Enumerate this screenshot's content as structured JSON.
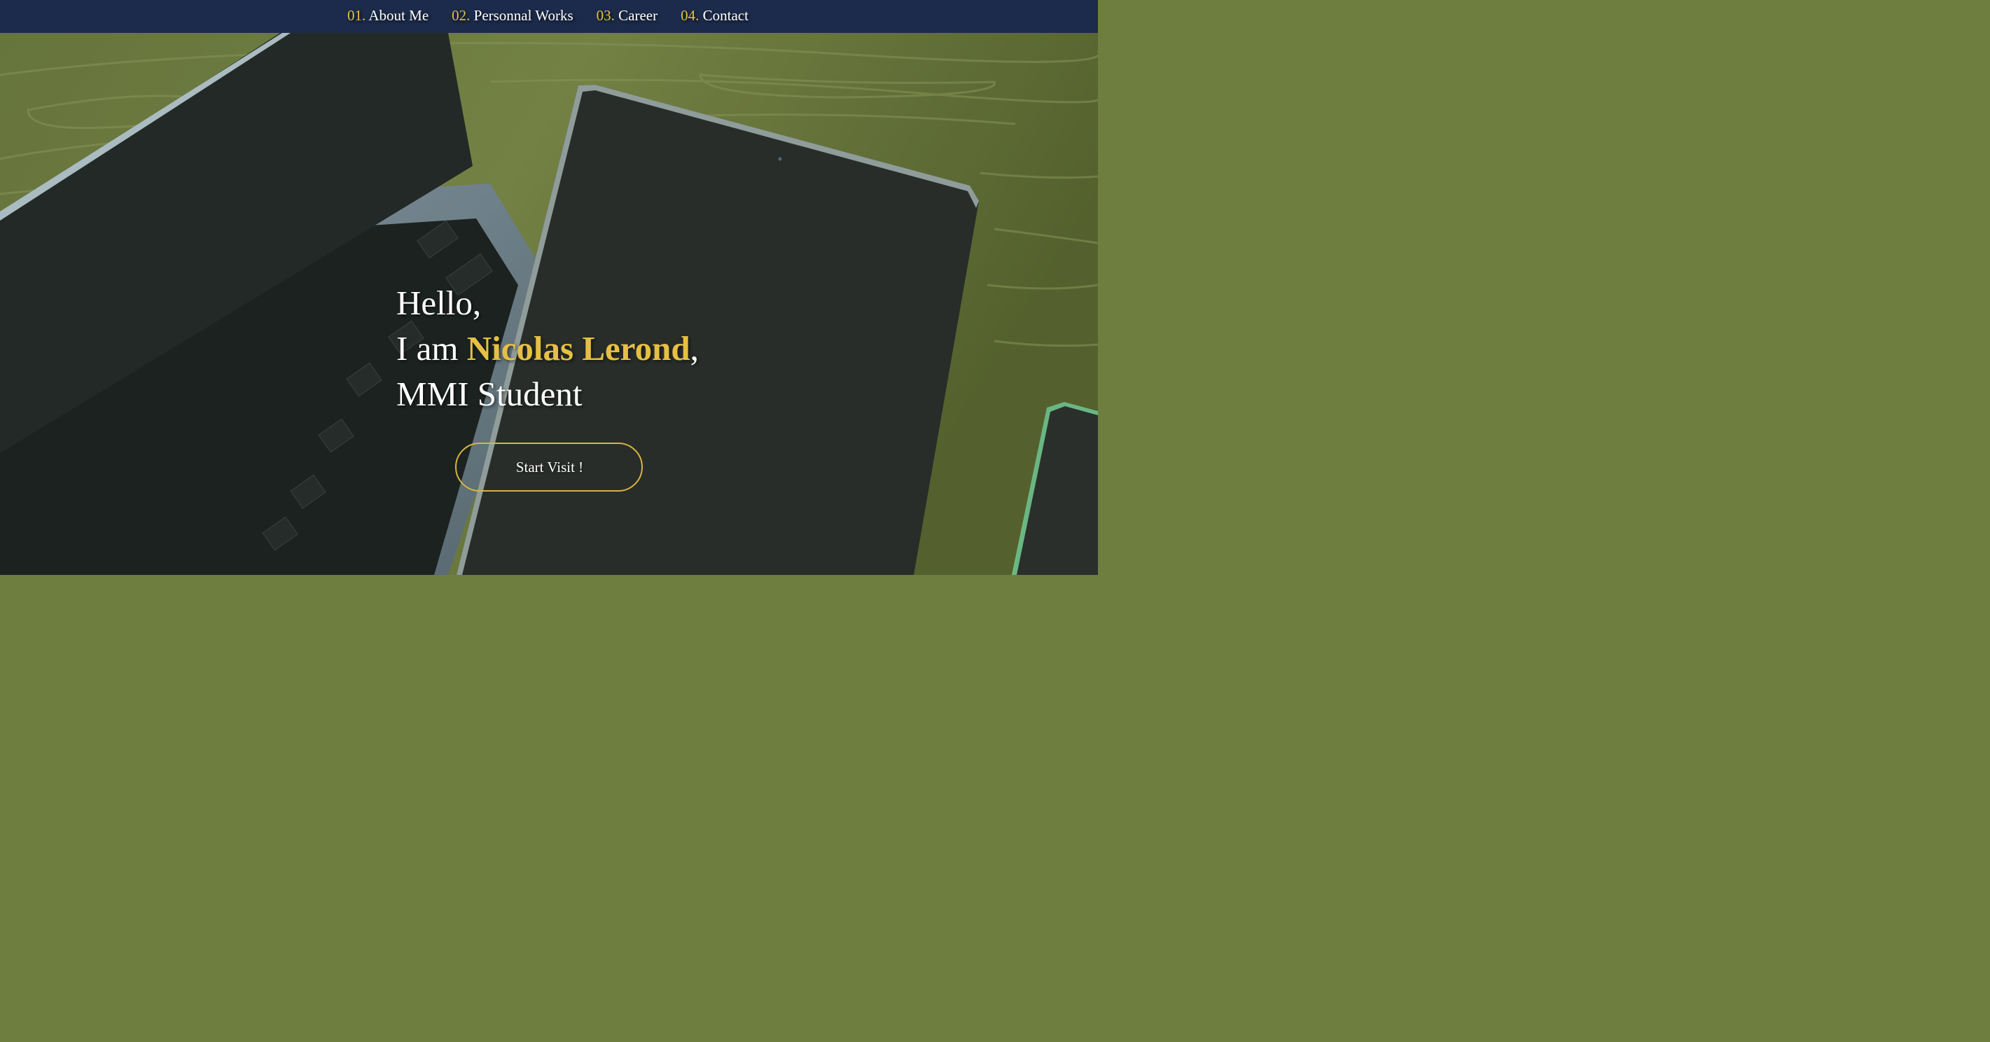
{
  "nav": {
    "items": [
      {
        "num": "01.",
        "label": "About Me"
      },
      {
        "num": "02.",
        "label": "Personnal Works"
      },
      {
        "num": "03.",
        "label": "Career"
      },
      {
        "num": "04.",
        "label": "Contact"
      }
    ]
  },
  "hero": {
    "greeting": "Hello,",
    "intro_prefix": "I am ",
    "name": "Nicolas Lerond",
    "intro_suffix": ",",
    "role": "MMI Student",
    "cta_label": "Start Visit !"
  },
  "background": {
    "description_icon": "laptop-tablet-phone-desk-photo"
  },
  "colors": {
    "nav_bg": "#1c2b4b",
    "accent": "#e6c042",
    "text": "#ffffff",
    "wood": "#6e7e3f",
    "device_dark": "#2c312d"
  }
}
